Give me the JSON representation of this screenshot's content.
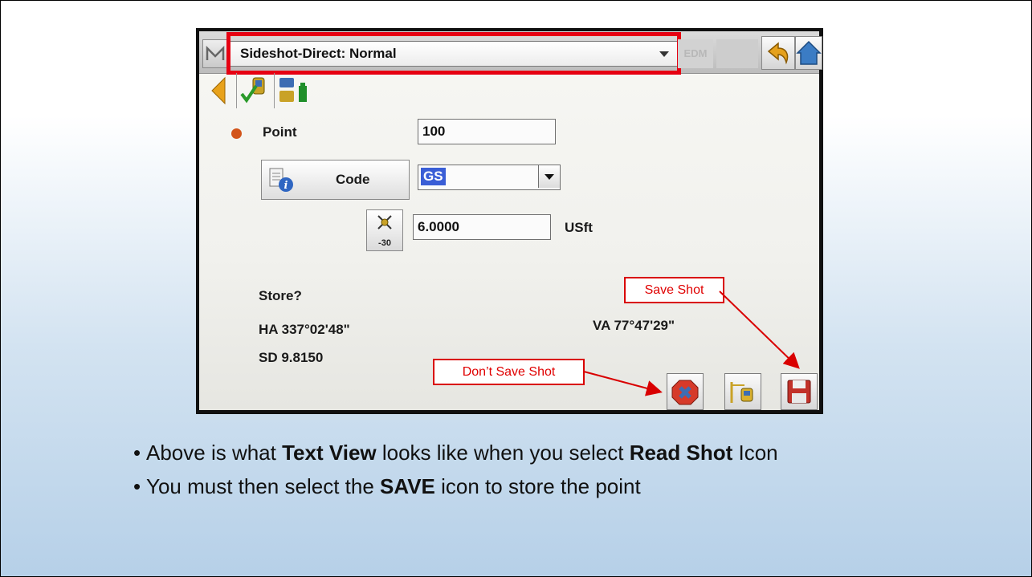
{
  "device": {
    "menu_icon": "menu-icon",
    "mode_select": {
      "value": "Sideshot-Direct: Normal"
    },
    "edm_button": "EDM",
    "point": {
      "label": "Point",
      "value": "100"
    },
    "code": {
      "button_label": "Code",
      "value": "GS"
    },
    "target_height": {
      "button_label": "-30",
      "value": "6.0000",
      "unit": "USft"
    },
    "store_prompt": "Store?",
    "ha": "HA 337°02'48\"",
    "va": "VA 77°47'29\"",
    "sd": "SD 9.8150",
    "colors": {
      "point_dot": "#d2541a",
      "code_highlight": "#3a5ed6",
      "annotation_red": "#e60012"
    }
  },
  "callouts": {
    "save_shot": "Save Shot",
    "dont_save_shot": "Don’t Save Shot"
  },
  "bullets": [
    {
      "pre": "Above is what ",
      "b1": "Text View",
      "mid": " looks like when you select ",
      "b2": "Read Shot",
      "post": " Icon"
    },
    {
      "pre": "You must then select the ",
      "b1": "SAVE",
      "mid": " icon to store the point"
    }
  ]
}
